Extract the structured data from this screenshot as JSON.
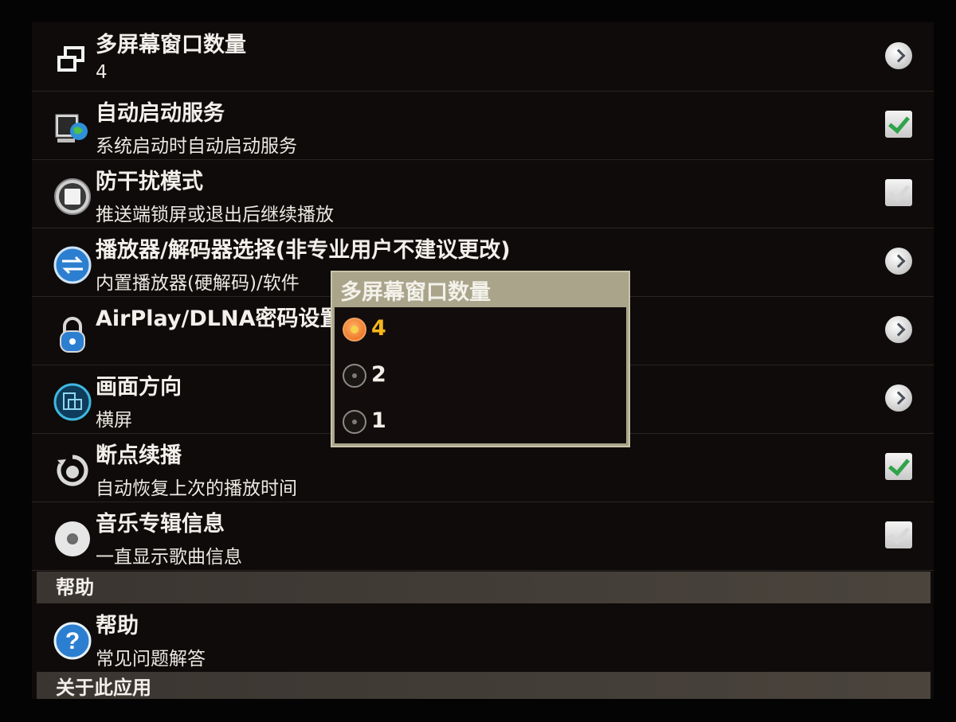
{
  "settings": [
    {
      "title": "多屏幕窗口数量",
      "subtitle": "4",
      "control": "arrow",
      "icon": "multi-window-icon"
    },
    {
      "title": "自动启动服务",
      "subtitle": "系统启动时自动启动服务",
      "control": "checkbox-on",
      "icon": "computer-globe-icon"
    },
    {
      "title": "防干扰模式",
      "subtitle": "推送端锁屏或退出后继续播放",
      "control": "checkbox-off",
      "icon": "shield-square-icon"
    },
    {
      "title": "播放器/解码器选择(非专业用户不建议更改)",
      "subtitle": "内置播放器(硬解码)/软件",
      "control": "arrow",
      "icon": "swap-arrows-icon"
    },
    {
      "title": "AirPlay/DLNA密码设置",
      "subtitle": "",
      "control": "arrow",
      "icon": "padlock-icon"
    },
    {
      "title": "画面方向",
      "subtitle": "横屏",
      "control": "arrow",
      "icon": "screen-rotate-icon"
    },
    {
      "title": "断点续播",
      "subtitle": "自动恢复上次的播放时间",
      "control": "checkbox-on",
      "icon": "resume-play-icon"
    },
    {
      "title": "音乐专辑信息",
      "subtitle": "一直显示歌曲信息",
      "control": "checkbox-off",
      "icon": "cd-disc-icon"
    }
  ],
  "sections": {
    "help_header": "帮助",
    "about_header": "关于此应用"
  },
  "help_item": {
    "title": "帮助",
    "subtitle": "常见问题解答",
    "icon": "question-icon"
  },
  "dialog": {
    "title": "多屏幕窗口数量",
    "options": [
      {
        "label": "4",
        "selected": true
      },
      {
        "label": "2",
        "selected": false
      },
      {
        "label": "1",
        "selected": false
      }
    ]
  },
  "colors": {
    "accent": "#f6b61c",
    "check_green": "#2fa34a",
    "background": "#0e0b0a"
  }
}
